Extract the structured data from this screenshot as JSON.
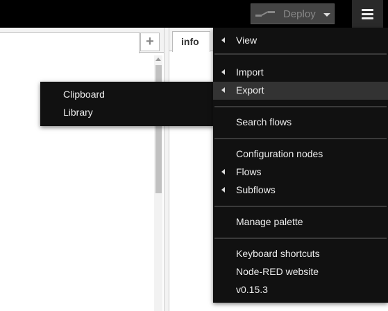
{
  "header": {
    "deploy_label": "Deploy",
    "menu_icon": "hamburger-icon",
    "deploy_icon": "deploy-icon"
  },
  "workspace": {
    "add_tab_label": "+"
  },
  "sidebar": {
    "active_tab": "info"
  },
  "main_menu": {
    "items": [
      {
        "label": "View",
        "has_submenu": true
      },
      {
        "label": "Import",
        "has_submenu": true
      },
      {
        "label": "Export",
        "has_submenu": true,
        "active": true
      },
      {
        "label": "Search flows",
        "has_submenu": false
      },
      {
        "label": "Configuration nodes",
        "has_submenu": false
      },
      {
        "label": "Flows",
        "has_submenu": true
      },
      {
        "label": "Subflows",
        "has_submenu": true
      },
      {
        "label": "Manage palette",
        "has_submenu": false
      },
      {
        "label": "Keyboard shortcuts",
        "has_submenu": false
      },
      {
        "label": "Node-RED website",
        "has_submenu": false
      },
      {
        "label": "v0.15.3",
        "has_submenu": false
      }
    ]
  },
  "export_submenu": {
    "items": [
      {
        "label": "Clipboard"
      },
      {
        "label": "Library"
      }
    ]
  },
  "colors": {
    "header_bg": "#000000",
    "menu_bg": "#111111",
    "menu_active_bg": "#333333",
    "menu_text": "#eeeeee",
    "deploy_bg": "#444444"
  }
}
